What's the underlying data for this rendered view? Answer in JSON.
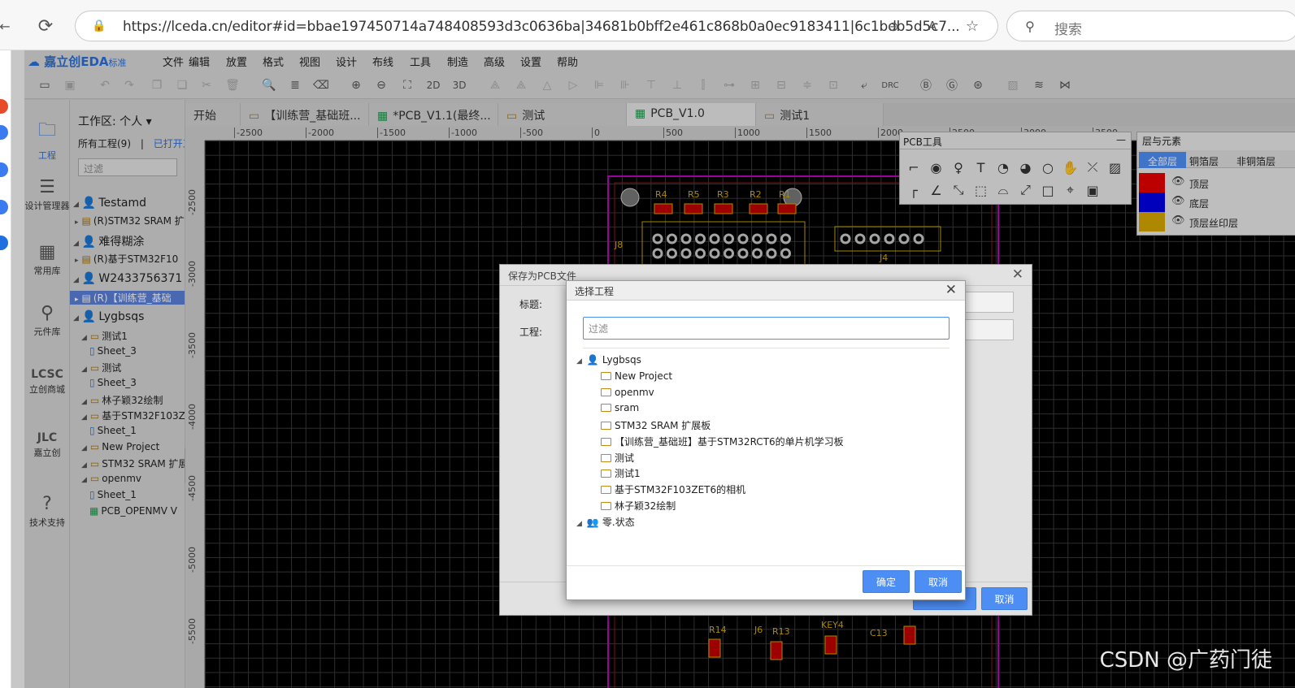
{
  "browser": {
    "url": "https://lceda.cn/editor#id=bbae197450714a748408593d3c0636ba|34681b0bff2e461c868b0a0ec9183411|6c1bdb5d5c7...",
    "search_placeholder": "搜索"
  },
  "app": {
    "logo": "嘉立创EDA",
    "edition": "标准",
    "menu": [
      "文件",
      "编辑",
      "放置",
      "格式",
      "视图",
      "设计",
      "布线",
      "工具",
      "制造",
      "高级",
      "设置",
      "帮助"
    ],
    "toolbar": {
      "label_2d": "2D",
      "label_3d": "3D",
      "label_drc": "DRC"
    }
  },
  "iconbar": [
    {
      "label": "工程",
      "icon": "folder-icon"
    },
    {
      "label": "设计管理器",
      "icon": "list-icon"
    },
    {
      "label": "常用库",
      "icon": "chip-icon"
    },
    {
      "label": "元件库",
      "icon": "search-icon"
    },
    {
      "label": "立创商城",
      "icon": "lcsc-icon"
    },
    {
      "label": "嘉立创",
      "icon": "jlc-icon"
    },
    {
      "label": "技术支持",
      "icon": "help-icon"
    }
  ],
  "tree": {
    "workspace": "工作区: 个人",
    "all_projects": "所有工程(9)",
    "separator": "|",
    "opened": "已打开工",
    "filter_placeholder": "过滤",
    "items": [
      {
        "text": "Testamd",
        "kind": "user"
      },
      {
        "text": "(R)STM32 SRAM 扩",
        "kind": "project"
      },
      {
        "text": "难得糊涂",
        "kind": "user"
      },
      {
        "text": "(R)基于STM32F10",
        "kind": "project"
      },
      {
        "text": "W2433756371",
        "kind": "user"
      },
      {
        "text": "(R)【训练营_基础",
        "kind": "project"
      },
      {
        "text": "Lygbsqs",
        "kind": "user"
      },
      {
        "text": "测试1",
        "kind": "folder"
      },
      {
        "text": "Sheet_3",
        "kind": "sheet"
      },
      {
        "text": "测试",
        "kind": "folder"
      },
      {
        "text": "Sheet_3",
        "kind": "sheet"
      },
      {
        "text": "林子颖32绘制",
        "kind": "folder"
      },
      {
        "text": "基于STM32F103Z",
        "kind": "folder"
      },
      {
        "text": "Sheet_1",
        "kind": "sheet"
      },
      {
        "text": "New Project",
        "kind": "folder"
      },
      {
        "text": "STM32 SRAM 扩展",
        "kind": "folder"
      },
      {
        "text": "openmv",
        "kind": "folder"
      },
      {
        "text": "Sheet_1",
        "kind": "sheet"
      },
      {
        "text": "PCB_OPENMV V",
        "kind": "pcb"
      }
    ]
  },
  "tabs": [
    {
      "label": "开始"
    },
    {
      "label": "【训练营_基础班..."
    },
    {
      "label": "*PCB_V1.1(最终..."
    },
    {
      "label": "测试"
    },
    {
      "label": "PCB_V1.0"
    },
    {
      "label": "测试1"
    }
  ],
  "ruler_h": [
    "-2500",
    "-2000",
    "-1500",
    "-1000",
    "-500",
    "0",
    "500",
    "1000",
    "1500",
    "2000",
    "2500",
    "3000",
    "3500"
  ],
  "ruler_v": [
    "-2500",
    "-3000",
    "-3500",
    "-4000",
    "-4500",
    "-5000",
    "-5500"
  ],
  "pcb_labels": [
    "R4",
    "R5",
    "R3",
    "R2",
    "R1",
    "J8",
    "J4",
    "R14",
    "J6",
    "R13",
    "KEY4",
    "C13"
  ],
  "pcbtools": {
    "title": "PCB工具",
    "close": "—"
  },
  "layers": {
    "title": "层与元素",
    "tabs": [
      "全部层",
      "铜箔层",
      "非铜箔层"
    ],
    "rows": [
      {
        "name": "顶层",
        "color": "#e60000"
      },
      {
        "name": "底层",
        "color": "#0000e6"
      },
      {
        "name": "顶层丝印层",
        "color": "#d4a700"
      }
    ]
  },
  "save_dialog": {
    "title": "保存为PCB文件",
    "title_label": "标题:",
    "project_label": "工程:",
    "cancel": "取消"
  },
  "project_dialog": {
    "title": "选择工程",
    "filter_placeholder": "过滤",
    "owner": "Lygbsqs",
    "projects": [
      "New Project",
      "openmv",
      "sram",
      "STM32 SRAM 扩展板",
      "【训练营_基础班】基于STM32RCT6的单片机学习板",
      "测试",
      "测试1",
      "基于STM32F103ZET6的相机",
      "林子颖32绘制"
    ],
    "team": "零.状态",
    "ok": "确定",
    "cancel": "取消"
  },
  "watermark": "CSDN @广药门徒"
}
